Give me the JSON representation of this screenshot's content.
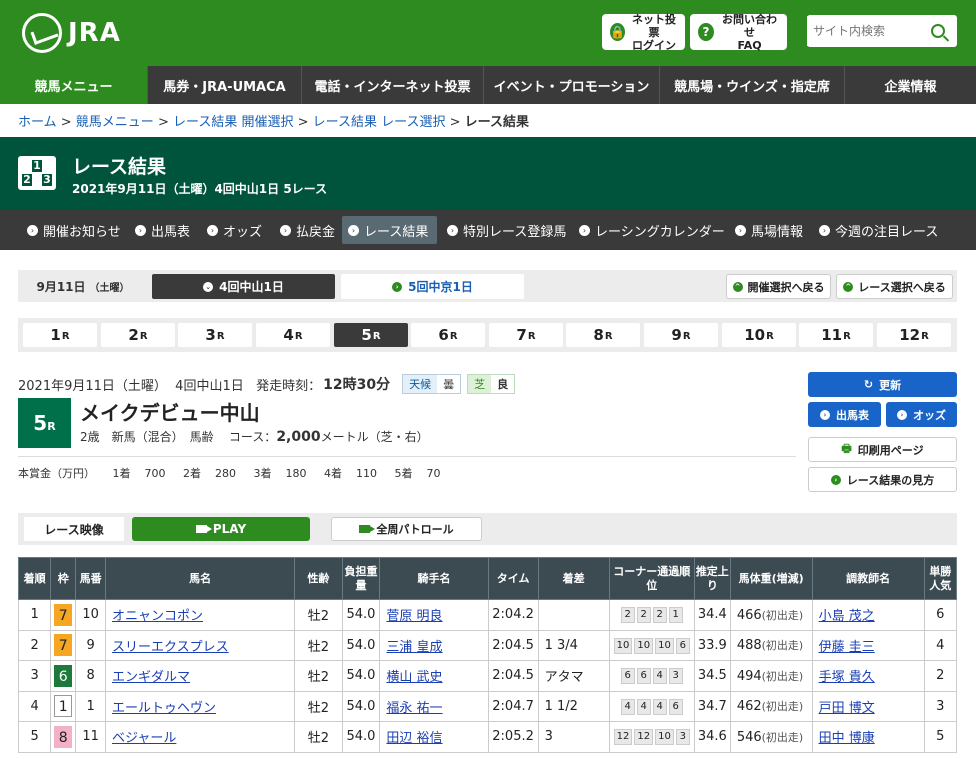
{
  "header": {
    "logo": "JRA",
    "login_line1": "ネット投票",
    "login_line2": "ログイン",
    "faq_line1": "お問い合わせ",
    "faq_line2": "FAQ",
    "search_placeholder": "サイト内検索"
  },
  "gnav": [
    "競馬メニュー",
    "馬券・JRA-UMACA",
    "電話・インターネット投票",
    "イベント・プロモーション",
    "競馬場・ウインズ・指定席",
    "企業情報"
  ],
  "breadcrumb": [
    "ホーム",
    "競馬メニュー",
    "レース結果 開催選択",
    "レース結果 レース選択",
    "レース結果"
  ],
  "title": {
    "main": "レース結果",
    "sub": "2021年9月11日（土曜）4回中山1日 5レース"
  },
  "subnav": [
    "開催お知らせ",
    "出馬表",
    "オッズ",
    "払戻金",
    "レース結果",
    "特別レース登録馬",
    "レーシングカレンダー",
    "馬場情報",
    "今週の注目レース"
  ],
  "venue": {
    "date": "9月11日",
    "weekday": "（土曜）",
    "tab_active": "4回中山1日",
    "tab_other": "5回中京1日",
    "back_venue": "開催選択へ戻る",
    "back_race": "レース選択へ戻る"
  },
  "races": [
    "1",
    "2",
    "3",
    "4",
    "5",
    "6",
    "7",
    "8",
    "9",
    "10",
    "11",
    "12"
  ],
  "race_suffix": "R",
  "race": {
    "date": "2021年9月11日（土曜）",
    "meeting": "4回中山1日",
    "start_label": "発走時刻：",
    "start_time": "12時30分",
    "weather_label": "天候",
    "weather": "曇",
    "track_label": "芝",
    "track_cond": "良",
    "number": "5",
    "name": "メイクデビュー中山",
    "cond": "2歳　新馬（混合）　馬齢",
    "course_label": "コース：",
    "distance": "2,000",
    "course_unit": "メートル（芝・右）"
  },
  "prize": {
    "label": "本賞金（万円）",
    "items": [
      "1着",
      "700",
      "2着",
      "280",
      "3着",
      "180",
      "4着",
      "110",
      "5着",
      "70"
    ]
  },
  "side": {
    "refresh": "更新",
    "entries": "出馬表",
    "odds": "オッズ",
    "print": "印刷用ページ",
    "howto": "レース結果の見方"
  },
  "video": {
    "label": "レース映像",
    "play": "PLAY",
    "patrol": "全周パトロール"
  },
  "table": {
    "headers": [
      "着順",
      "枠",
      "馬番",
      "馬名",
      "性齢",
      "負担重量",
      "騎手名",
      "タイム",
      "着差",
      "コーナー通過順位",
      "推定上り",
      "馬体重(増減)",
      "調教師名",
      "単勝人気"
    ],
    "rows": [
      {
        "rank": "1",
        "waku": "7",
        "umaban": "10",
        "horse": "オニャンコポン",
        "sexage": "牡2",
        "weight": "54.0",
        "jockey": "菅原 明良",
        "time": "2:04.2",
        "margin": "",
        "corners": [
          "2",
          "2",
          "2",
          "1"
        ],
        "last3f": "34.4",
        "body": "466",
        "diff": "(初出走)",
        "trainer": "小島 茂之",
        "pop": "6"
      },
      {
        "rank": "2",
        "waku": "7",
        "umaban": "9",
        "horse": "スリーエクスプレス",
        "sexage": "牡2",
        "weight": "54.0",
        "jockey": "三浦 皇成",
        "time": "2:04.5",
        "margin": "1 3/4",
        "corners": [
          "10",
          "10",
          "10",
          "6"
        ],
        "last3f": "33.9",
        "body": "488",
        "diff": "(初出走)",
        "trainer": "伊藤 圭三",
        "pop": "4"
      },
      {
        "rank": "3",
        "waku": "6",
        "umaban": "8",
        "horse": "エンギダルマ",
        "sexage": "牡2",
        "weight": "54.0",
        "jockey": "横山 武史",
        "time": "2:04.5",
        "margin": "アタマ",
        "corners": [
          "6",
          "6",
          "4",
          "3"
        ],
        "last3f": "34.5",
        "body": "494",
        "diff": "(初出走)",
        "trainer": "手塚 貴久",
        "pop": "2"
      },
      {
        "rank": "4",
        "waku": "1",
        "umaban": "1",
        "horse": "エールトゥヘヴン",
        "sexage": "牡2",
        "weight": "54.0",
        "jockey": "福永 祐一",
        "time": "2:04.7",
        "margin": "1 1/2",
        "corners": [
          "4",
          "4",
          "4",
          "6"
        ],
        "last3f": "34.7",
        "body": "462",
        "diff": "(初出走)",
        "trainer": "戸田 博文",
        "pop": "3"
      },
      {
        "rank": "5",
        "waku": "8",
        "umaban": "11",
        "horse": "ベジャール",
        "sexage": "牡2",
        "weight": "54.0",
        "jockey": "田辺 裕信",
        "time": "2:05.2",
        "margin": "3",
        "corners": [
          "12",
          "12",
          "10",
          "3"
        ],
        "last3f": "34.6",
        "body": "546",
        "diff": "(初出走)",
        "trainer": "田中 博康",
        "pop": "5"
      }
    ]
  },
  "colors": {
    "green": "#2e8b1f",
    "dark_green": "#00543b",
    "waku_7": "#f5a623",
    "waku_6": "#1e7a3a",
    "waku_1": "#ffffff",
    "waku_8": "#f4b0c8"
  }
}
